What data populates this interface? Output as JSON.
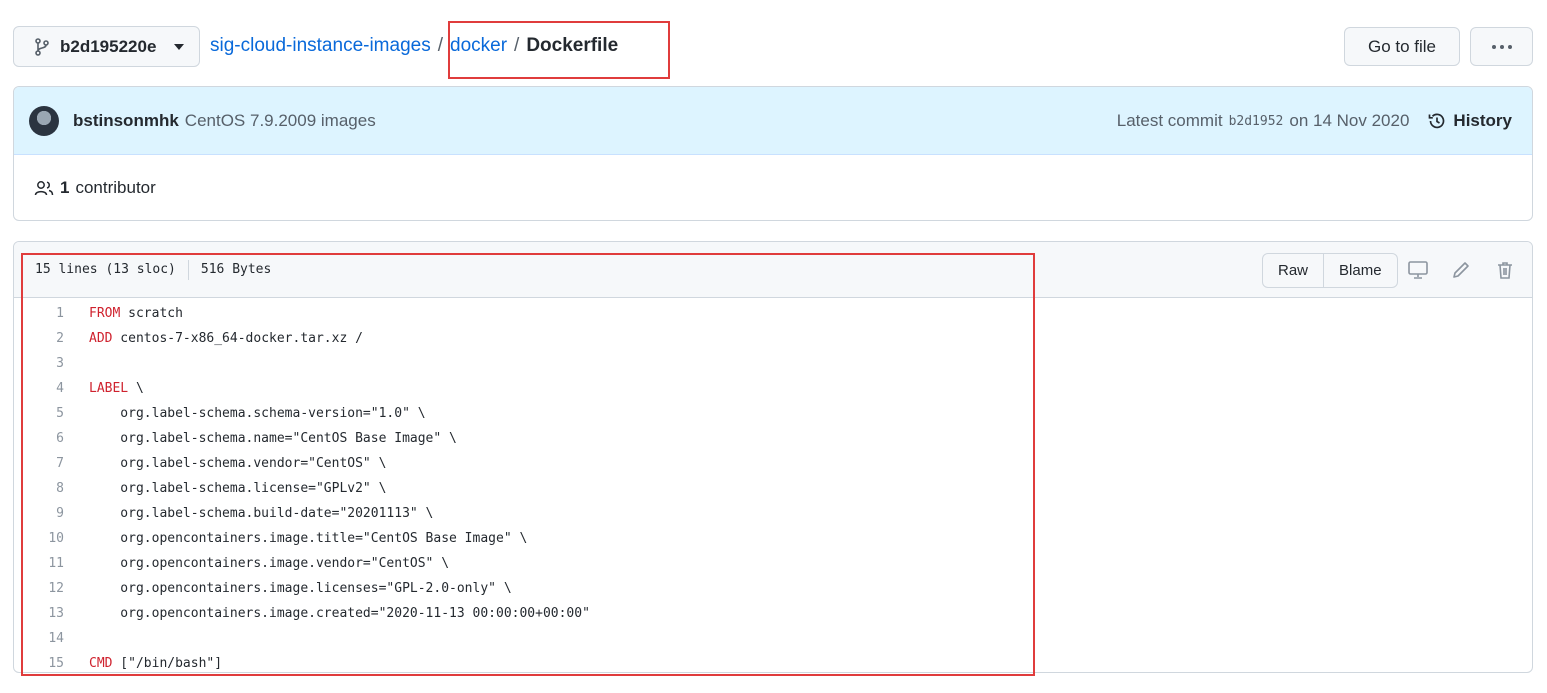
{
  "branch": {
    "name": "b2d195220e"
  },
  "breadcrumb": {
    "repo": "sig-cloud-instance-images",
    "sep1": "/",
    "folder": "docker",
    "sep2": "/",
    "file": "Dockerfile"
  },
  "header_actions": {
    "goto_file": "Go to file"
  },
  "commit": {
    "author": "bstinsonmhk",
    "message": "CentOS 7.9.2009 images",
    "latest_prefix": "Latest commit",
    "sha": "b2d1952",
    "date": "on 14 Nov 2020",
    "history_label": "History",
    "contributors_count": "1",
    "contributors_label": "contributor"
  },
  "file": {
    "lines_info": "15 lines (13 sloc)",
    "size": "516 Bytes",
    "raw_label": "Raw",
    "blame_label": "Blame",
    "lines": [
      {
        "n": "1",
        "kw": "FROM",
        "rest": " scratch"
      },
      {
        "n": "2",
        "kw": "ADD",
        "rest": " centos-7-x86_64-docker.tar.xz /"
      },
      {
        "n": "3",
        "kw": "",
        "rest": ""
      },
      {
        "n": "4",
        "kw": "LABEL",
        "rest": " \\"
      },
      {
        "n": "5",
        "kw": "",
        "rest": "    org.label-schema.schema-version=\"1.0\" \\"
      },
      {
        "n": "6",
        "kw": "",
        "rest": "    org.label-schema.name=\"CentOS Base Image\" \\"
      },
      {
        "n": "7",
        "kw": "",
        "rest": "    org.label-schema.vendor=\"CentOS\" \\"
      },
      {
        "n": "8",
        "kw": "",
        "rest": "    org.label-schema.license=\"GPLv2\" \\"
      },
      {
        "n": "9",
        "kw": "",
        "rest": "    org.label-schema.build-date=\"20201113\" \\"
      },
      {
        "n": "10",
        "kw": "",
        "rest": "    org.opencontainers.image.title=\"CentOS Base Image\" \\"
      },
      {
        "n": "11",
        "kw": "",
        "rest": "    org.opencontainers.image.vendor=\"CentOS\" \\"
      },
      {
        "n": "12",
        "kw": "",
        "rest": "    org.opencontainers.image.licenses=\"GPL-2.0-only\" \\"
      },
      {
        "n": "13",
        "kw": "",
        "rest": "    org.opencontainers.image.created=\"2020-11-13 00:00:00+00:00\""
      },
      {
        "n": "14",
        "kw": "",
        "rest": ""
      },
      {
        "n": "15",
        "kw": "CMD",
        "rest": " [\"/bin/bash\"]"
      }
    ]
  },
  "colors": {
    "link": "#0969da",
    "keyword": "#cf222e",
    "highlight": "#e03c3c",
    "commit_bg": "#ddf4ff"
  }
}
